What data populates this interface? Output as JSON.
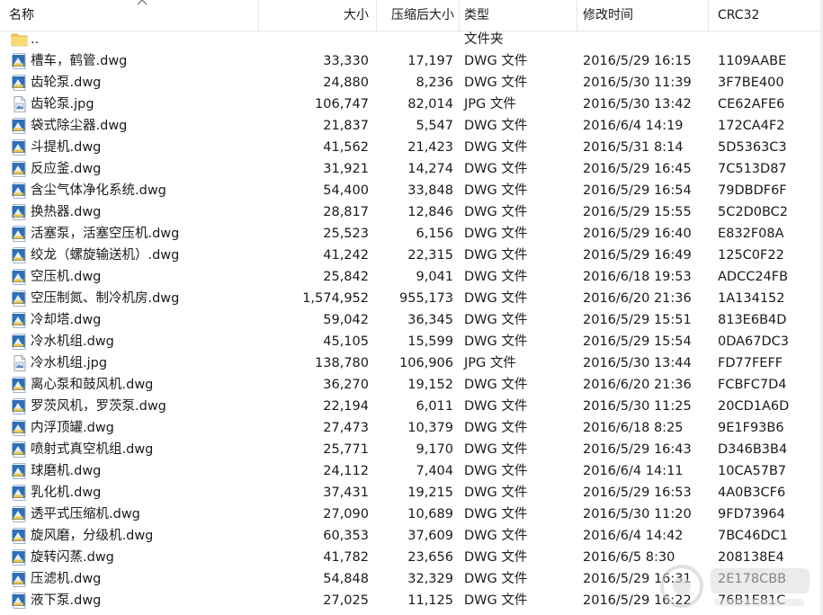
{
  "columns": {
    "name": "名称",
    "size": "大小",
    "compressed": "压缩后大小",
    "type": "类型",
    "modified": "修改时间",
    "crc": "CRC32"
  },
  "rows": [
    {
      "icon": "folder-up-icon",
      "name": "..",
      "size": "",
      "compressed": "",
      "type": "文件夹",
      "modified": "",
      "crc": ""
    },
    {
      "icon": "dwg-file-icon",
      "name": "槽车，鹤管.dwg",
      "size": "33,330",
      "compressed": "17,197",
      "type": "DWG 文件",
      "modified": "2016/5/29 16:15",
      "crc": "1109AABE"
    },
    {
      "icon": "dwg-file-icon",
      "name": "齿轮泵.dwg",
      "size": "24,880",
      "compressed": "8,236",
      "type": "DWG 文件",
      "modified": "2016/5/30 11:39",
      "crc": "3F7BE400"
    },
    {
      "icon": "jpg-file-icon",
      "name": "齿轮泵.jpg",
      "size": "106,747",
      "compressed": "82,014",
      "type": "JPG 文件",
      "modified": "2016/5/30 13:42",
      "crc": "CE62AFE6"
    },
    {
      "icon": "dwg-file-icon",
      "name": "袋式除尘器.dwg",
      "size": "21,837",
      "compressed": "5,547",
      "type": "DWG 文件",
      "modified": "2016/6/4 14:19",
      "crc": "172CA4F2"
    },
    {
      "icon": "dwg-file-icon",
      "name": "斗提机.dwg",
      "size": "41,562",
      "compressed": "21,423",
      "type": "DWG 文件",
      "modified": "2016/5/31 8:14",
      "crc": "5D5363C3"
    },
    {
      "icon": "dwg-file-icon",
      "name": "反应釜.dwg",
      "size": "31,921",
      "compressed": "14,274",
      "type": "DWG 文件",
      "modified": "2016/5/29 16:45",
      "crc": "7C513D87"
    },
    {
      "icon": "dwg-file-icon",
      "name": "含尘气体净化系统.dwg",
      "size": "54,400",
      "compressed": "33,848",
      "type": "DWG 文件",
      "modified": "2016/5/29 16:54",
      "crc": "79DBDF6F"
    },
    {
      "icon": "dwg-file-icon",
      "name": "换热器.dwg",
      "size": "28,817",
      "compressed": "12,846",
      "type": "DWG 文件",
      "modified": "2016/5/29 15:55",
      "crc": "5C2D0BC2"
    },
    {
      "icon": "dwg-file-icon",
      "name": "活塞泵，活塞空压机.dwg",
      "size": "25,523",
      "compressed": "6,156",
      "type": "DWG 文件",
      "modified": "2016/5/29 16:40",
      "crc": "E832F08A"
    },
    {
      "icon": "dwg-file-icon",
      "name": "绞龙（螺旋输送机）.dwg",
      "size": "41,242",
      "compressed": "22,315",
      "type": "DWG 文件",
      "modified": "2016/5/29 16:49",
      "crc": "125C0F22"
    },
    {
      "icon": "dwg-file-icon",
      "name": "空压机.dwg",
      "size": "25,842",
      "compressed": "9,041",
      "type": "DWG 文件",
      "modified": "2016/6/18 19:53",
      "crc": "ADCC24FB"
    },
    {
      "icon": "dwg-file-icon",
      "name": "空压制氮、制冷机房.dwg",
      "size": "1,574,952",
      "compressed": "955,173",
      "type": "DWG 文件",
      "modified": "2016/6/20 21:36",
      "crc": "1A134152"
    },
    {
      "icon": "dwg-file-icon",
      "name": "冷却塔.dwg",
      "size": "59,042",
      "compressed": "36,345",
      "type": "DWG 文件",
      "modified": "2016/5/29 15:51",
      "crc": "813E6B4D"
    },
    {
      "icon": "dwg-file-icon",
      "name": "冷水机组.dwg",
      "size": "45,105",
      "compressed": "15,599",
      "type": "DWG 文件",
      "modified": "2016/5/29 15:54",
      "crc": "0DA67DC3"
    },
    {
      "icon": "jpg-file-icon",
      "name": "冷水机组.jpg",
      "size": "138,780",
      "compressed": "106,906",
      "type": "JPG 文件",
      "modified": "2016/5/30 13:44",
      "crc": "FD77FEFF"
    },
    {
      "icon": "dwg-file-icon",
      "name": "离心泵和鼓风机.dwg",
      "size": "36,270",
      "compressed": "19,152",
      "type": "DWG 文件",
      "modified": "2016/6/20 21:36",
      "crc": "FCBFC7D4"
    },
    {
      "icon": "dwg-file-icon",
      "name": "罗茨风机，罗茨泵.dwg",
      "size": "22,194",
      "compressed": "6,011",
      "type": "DWG 文件",
      "modified": "2016/5/30 11:25",
      "crc": "20CD1A6D"
    },
    {
      "icon": "dwg-file-icon",
      "name": "内浮顶罐.dwg",
      "size": "27,473",
      "compressed": "10,379",
      "type": "DWG 文件",
      "modified": "2016/6/18 8:25",
      "crc": "9E1F93B6"
    },
    {
      "icon": "dwg-file-icon",
      "name": "喷射式真空机组.dwg",
      "size": "25,771",
      "compressed": "9,170",
      "type": "DWG 文件",
      "modified": "2016/5/29 16:43",
      "crc": "D346B3B4"
    },
    {
      "icon": "dwg-file-icon",
      "name": "球磨机.dwg",
      "size": "24,112",
      "compressed": "7,404",
      "type": "DWG 文件",
      "modified": "2016/6/4 14:11",
      "crc": "10CA57B7"
    },
    {
      "icon": "dwg-file-icon",
      "name": "乳化机.dwg",
      "size": "37,431",
      "compressed": "19,215",
      "type": "DWG 文件",
      "modified": "2016/5/29 16:53",
      "crc": "4A0B3CF6"
    },
    {
      "icon": "dwg-file-icon",
      "name": "透平式压缩机.dwg",
      "size": "27,090",
      "compressed": "10,689",
      "type": "DWG 文件",
      "modified": "2016/5/30 11:20",
      "crc": "9FD73964"
    },
    {
      "icon": "dwg-file-icon",
      "name": "旋风磨，分级机.dwg",
      "size": "60,353",
      "compressed": "37,609",
      "type": "DWG 文件",
      "modified": "2016/6/4 14:42",
      "crc": "7BC46DC1"
    },
    {
      "icon": "dwg-file-icon",
      "name": "旋转闪蒸.dwg",
      "size": "41,782",
      "compressed": "23,656",
      "type": "DWG 文件",
      "modified": "2016/6/5 8:30",
      "crc": "208138E4"
    },
    {
      "icon": "dwg-file-icon",
      "name": "压滤机.dwg",
      "size": "54,848",
      "compressed": "32,329",
      "type": "DWG 文件",
      "modified": "2016/5/29 16:31",
      "crc": "2E178CBB"
    },
    {
      "icon": "dwg-file-icon",
      "name": "液下泵.dwg",
      "size": "27,025",
      "compressed": "11,125",
      "type": "DWG 文件",
      "modified": "2016/5/29 16:22",
      "crc": "76B1E81C"
    }
  ]
}
